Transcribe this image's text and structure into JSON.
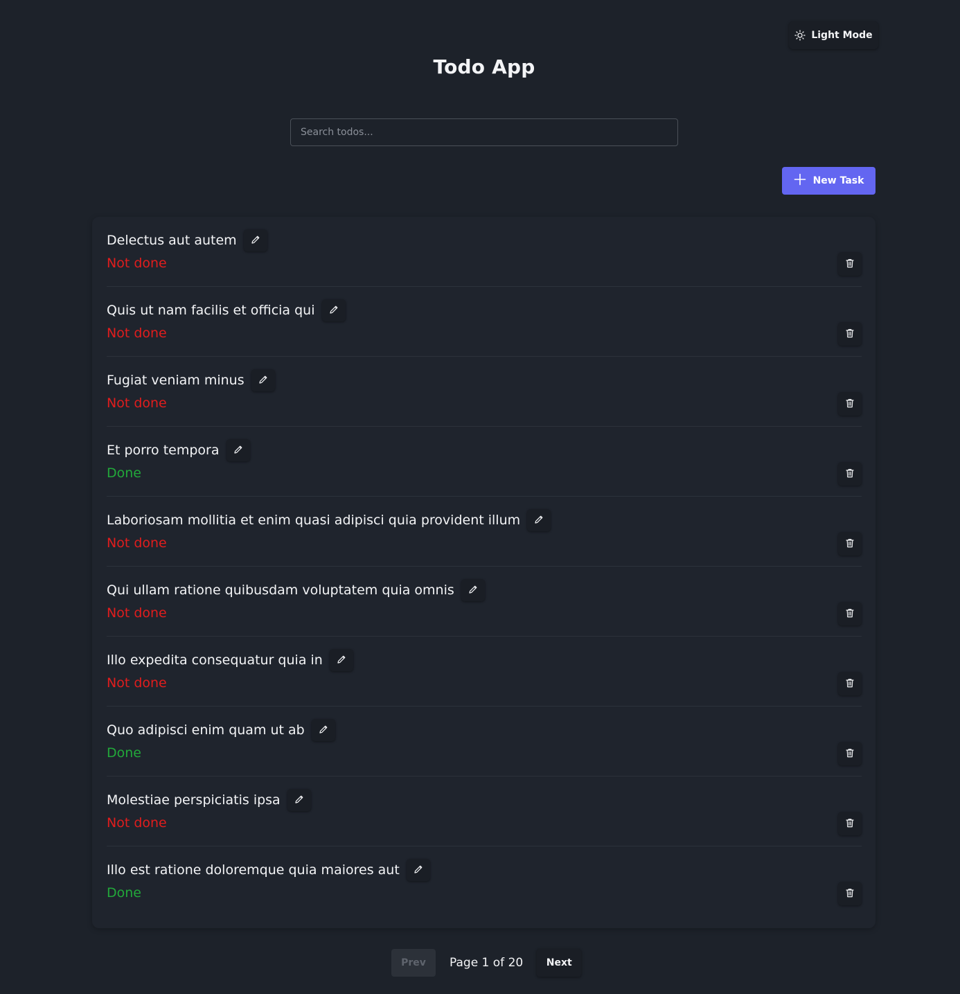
{
  "header": {
    "title": "Todo App",
    "theme_toggle_label": "Light Mode",
    "theme_toggle_icon": "sun-icon"
  },
  "search": {
    "placeholder": "Search todos...",
    "value": ""
  },
  "toolbar": {
    "new_task_label": "New Task",
    "new_task_icon": "plus-icon"
  },
  "todos": [
    {
      "title": "Delectus aut autem",
      "status": "Not done",
      "done": false
    },
    {
      "title": "Quis ut nam facilis et officia qui",
      "status": "Not done",
      "done": false
    },
    {
      "title": "Fugiat veniam minus",
      "status": "Not done",
      "done": false
    },
    {
      "title": "Et porro tempora",
      "status": "Done",
      "done": true
    },
    {
      "title": "Laboriosam mollitia et enim quasi adipisci quia provident illum",
      "status": "Not done",
      "done": false
    },
    {
      "title": "Qui ullam ratione quibusdam voluptatem quia omnis",
      "status": "Not done",
      "done": false
    },
    {
      "title": "Illo expedita consequatur quia in",
      "status": "Not done",
      "done": false
    },
    {
      "title": "Quo adipisci enim quam ut ab",
      "status": "Done",
      "done": true
    },
    {
      "title": "Molestiae perspiciatis ipsa",
      "status": "Not done",
      "done": false
    },
    {
      "title": "Illo est ratione doloremque quia maiores aut",
      "status": "Done",
      "done": true
    }
  ],
  "item_icons": {
    "edit": "pencil-icon",
    "delete": "trash-icon"
  },
  "colors": {
    "background": "#1d222a",
    "card": "#1f242d",
    "accent": "#6366f1",
    "not_done": "#e11d1d",
    "done": "#22a83a"
  },
  "pagination": {
    "prev_label": "Prev",
    "next_label": "Next",
    "page_text": "Page 1 of 20",
    "current_page": 1,
    "total_pages": 20
  }
}
